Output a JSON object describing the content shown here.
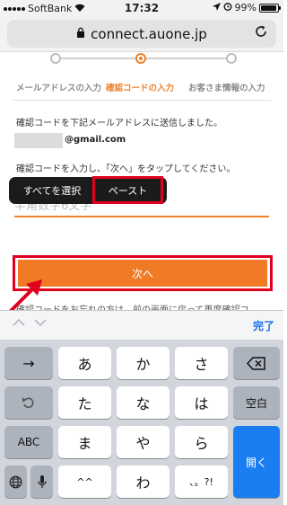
{
  "status_bar": {
    "carrier": "SoftBank",
    "time": "17:32",
    "battery": "99%",
    "battery_level": 0.99
  },
  "browser": {
    "url": "connect.auone.jp"
  },
  "steps": [
    {
      "label": "メールアドレスの入力",
      "active": false
    },
    {
      "label": "確認コードの入力",
      "active": true
    },
    {
      "label": "お客さま情報の入力",
      "active": false
    }
  ],
  "content": {
    "instruction": "確認コードを下記メールアドレスに送信しました。",
    "email_suffix": "@gmail.com",
    "prompt": "確認コードを入力し、「次へ」をタップしてください。",
    "code_placeholder": "半角数字6文字",
    "next_label": "次へ",
    "partial_text": "確認コードをお忘れの方は、前の画面に戻って再度確認コ"
  },
  "context_menu": {
    "select_all": "すべてを選択",
    "paste": "ペースト"
  },
  "keyboard_accessory": {
    "done_label": "完了"
  },
  "keyboard": {
    "row1": {
      "left": "→",
      "keys": [
        "あ",
        "か",
        "さ"
      ],
      "right": "⌫"
    },
    "row2": {
      "left": "↺",
      "keys": [
        "た",
        "な",
        "は"
      ],
      "right": "空白"
    },
    "row3": {
      "left": "ABC",
      "keys": [
        "ま",
        "や",
        "ら"
      ],
      "right": "開く"
    },
    "row4": {
      "keys": [
        "^^",
        "わ",
        "、。?!"
      ]
    }
  },
  "colors": {
    "accent": "#f07a26",
    "highlight_red": "#e0001e",
    "link_blue": "#1a6ee6"
  }
}
